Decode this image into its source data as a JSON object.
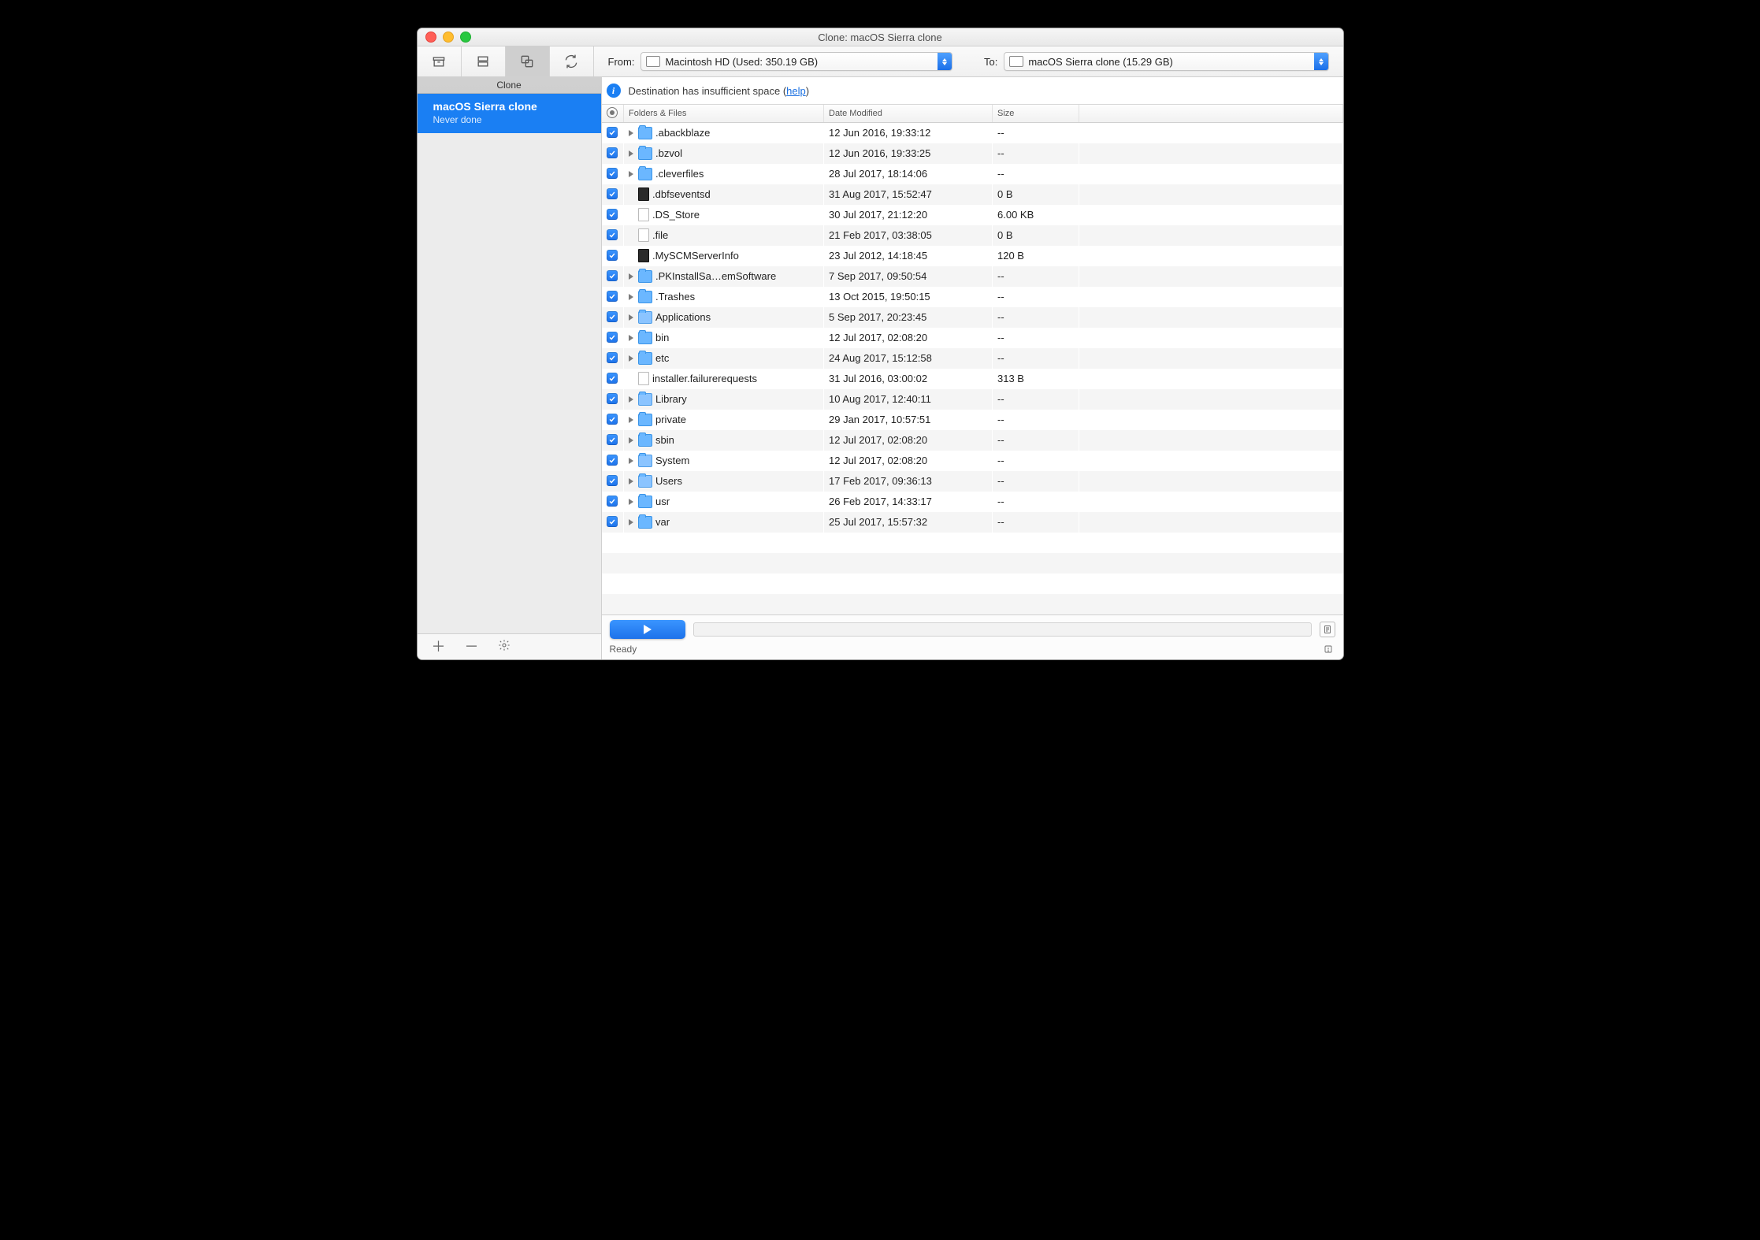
{
  "window": {
    "title": "Clone: macOS Sierra clone"
  },
  "sidebar_heading": "Clone",
  "sidebar": {
    "item": {
      "name": "macOS Sierra clone",
      "subtitle": "Never done"
    }
  },
  "pickers": {
    "from_label": "From:",
    "from_value": "Macintosh HD (Used: 350.19 GB)",
    "to_label": "To:",
    "to_value": "macOS Sierra clone (15.29 GB)"
  },
  "warning": {
    "text_prefix": "Destination has insufficient space (",
    "link_text": "help",
    "text_suffix": ")"
  },
  "columns": {
    "c0": "",
    "c1": "Folders & Files",
    "c2": "Date Modified",
    "c3": "Size"
  },
  "rows": [
    {
      "expand": true,
      "icon": "folder",
      "name": ".abackblaze",
      "date": "12 Jun 2016, 19:33:12",
      "size": "--"
    },
    {
      "expand": true,
      "icon": "folder",
      "name": ".bzvol",
      "date": "12 Jun 2016, 19:33:25",
      "size": "--"
    },
    {
      "expand": true,
      "icon": "folder",
      "name": ".cleverfiles",
      "date": "28 Jul 2017, 18:14:06",
      "size": "--"
    },
    {
      "expand": false,
      "icon": "exec",
      "name": ".dbfseventsd",
      "date": "31 Aug 2017, 15:52:47",
      "size": "0 B"
    },
    {
      "expand": false,
      "icon": "file",
      "name": ".DS_Store",
      "date": "30 Jul 2017, 21:12:20",
      "size": "6.00 KB"
    },
    {
      "expand": false,
      "icon": "file",
      "name": ".file",
      "date": "21 Feb 2017, 03:38:05",
      "size": "0 B"
    },
    {
      "expand": false,
      "icon": "exec",
      "name": ".MySCMServerInfo",
      "date": "23 Jul 2012, 14:18:45",
      "size": "120 B"
    },
    {
      "expand": true,
      "icon": "folder",
      "name": ".PKInstallSa…emSoftware",
      "date": "7 Sep 2017, 09:50:54",
      "size": "--"
    },
    {
      "expand": true,
      "icon": "folder",
      "name": ".Trashes",
      "date": "13 Oct 2015, 19:50:15",
      "size": "--"
    },
    {
      "expand": true,
      "icon": "folder-sys",
      "name": "Applications",
      "date": "5 Sep 2017, 20:23:45",
      "size": "--"
    },
    {
      "expand": true,
      "icon": "folder",
      "name": "bin",
      "date": "12 Jul 2017, 02:08:20",
      "size": "--"
    },
    {
      "expand": true,
      "icon": "folder",
      "name": "etc",
      "date": "24 Aug 2017, 15:12:58",
      "size": "--"
    },
    {
      "expand": false,
      "icon": "file",
      "name": "installer.failurerequests",
      "date": "31 Jul 2016, 03:00:02",
      "size": "313 B"
    },
    {
      "expand": true,
      "icon": "folder-sys",
      "name": "Library",
      "date": "10 Aug 2017, 12:40:11",
      "size": "--"
    },
    {
      "expand": true,
      "icon": "folder",
      "name": "private",
      "date": "29 Jan 2017, 10:57:51",
      "size": "--"
    },
    {
      "expand": true,
      "icon": "folder",
      "name": "sbin",
      "date": "12 Jul 2017, 02:08:20",
      "size": "--"
    },
    {
      "expand": true,
      "icon": "folder-sys",
      "name": "System",
      "date": "12 Jul 2017, 02:08:20",
      "size": "--"
    },
    {
      "expand": true,
      "icon": "folder-sys",
      "name": "Users",
      "date": "17 Feb 2017, 09:36:13",
      "size": "--"
    },
    {
      "expand": true,
      "icon": "folder",
      "name": "usr",
      "date": "26 Feb 2017, 14:33:17",
      "size": "--"
    },
    {
      "expand": true,
      "icon": "folder",
      "name": "var",
      "date": "25 Jul 2017, 15:57:32",
      "size": "--"
    }
  ],
  "footer": {
    "status": "Ready"
  }
}
